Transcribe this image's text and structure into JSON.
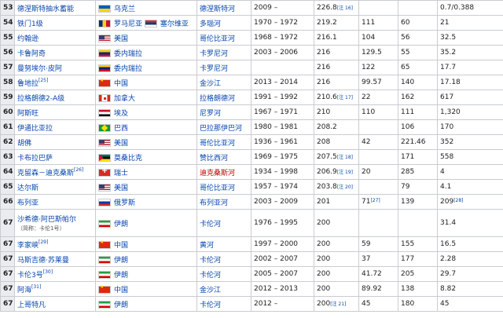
{
  "rows": [
    {
      "rank": "53",
      "name": "德涅斯特抽水蓄能",
      "flags": [
        "ua"
      ],
      "country": "乌克兰",
      "river": "德涅斯特河",
      "years": "2009 –",
      "height": "226.8",
      "height_ref": "[注 16]",
      "c6": "",
      "c7": "",
      "c8": "0.7/0.388"
    },
    {
      "rank": "54",
      "name": "铁门1级",
      "flags": [
        "ro",
        "rs"
      ],
      "country": "罗马尼亚",
      "country2": "塞尔维亚",
      "river": "多瑙河",
      "years": "1970 – 1972",
      "height": "219.2",
      "height_ref": "",
      "c6": "111",
      "c7": "60",
      "c8": "21"
    },
    {
      "rank": "55",
      "name": "约翰逊",
      "flags": [
        "us"
      ],
      "country": "美国",
      "river": "哥伦比亚河",
      "years": "1968 – 1972",
      "height": "216.1",
      "height_ref": "",
      "c6": "104",
      "c7": "56",
      "c8": "32.5"
    },
    {
      "rank": "56",
      "name": "卡鲁阿奇",
      "flags": [
        "ve"
      ],
      "country": "委内瑞拉",
      "river": "卡罗尼河",
      "years": "2003 – 2006",
      "height": "216",
      "height_ref": "",
      "c6": "129.5",
      "c7": "55",
      "c8": "35.2"
    },
    {
      "rank": "57",
      "name": "曼努埃尔·皮阿",
      "flags": [
        "ve"
      ],
      "country": "委内瑞拉",
      "river": "卡罗尼河",
      "years": "",
      "height": "216",
      "height_ref": "",
      "c6": "122",
      "c7": "65",
      "c8": "17.7"
    },
    {
      "rank": "58",
      "name": "鲁地拉",
      "name_ref": "[25]",
      "flags": [
        "cn"
      ],
      "country": "中国",
      "river": "金沙江",
      "years": "2013 – 2014",
      "height": "216",
      "height_ref": "",
      "c6": "99.57",
      "c7": "140",
      "c8": "17.18"
    },
    {
      "rank": "59",
      "name": "拉格朗德2-A级",
      "flags": [
        "ca"
      ],
      "country": "加拿大",
      "river": "拉格朗德河",
      "years": "1991 – 1992",
      "height": "210.6",
      "height_ref": "[注 17]",
      "c6": "22",
      "c7": "162",
      "c8": "617"
    },
    {
      "rank": "60",
      "name": "阿斯旺",
      "flags": [
        "eg"
      ],
      "country": "埃及",
      "river": "尼罗河",
      "years": "1967 – 1971",
      "height": "210",
      "height_ref": "",
      "c6": "110",
      "c7": "111",
      "c8": "1,320"
    },
    {
      "rank": "61",
      "name": "伊通比亚拉",
      "flags": [
        "br"
      ],
      "country": "巴西",
      "river": "巴拉那伊巴河",
      "years": "1980 – 1981",
      "height": "208.2",
      "height_ref": "",
      "c6": "",
      "c7": "106",
      "c8": "170"
    },
    {
      "rank": "62",
      "name": "胡佛",
      "flags": [
        "us"
      ],
      "country": "美国",
      "river": "哥伦比亚河",
      "years": "1936 – 1961",
      "height": "208",
      "height_ref": "",
      "c6": "42",
      "c7": "221.46",
      "c8": "352"
    },
    {
      "rank": "63",
      "name": "卡布拉巴萨",
      "flags": [
        "mz"
      ],
      "country": "莫桑比克",
      "river": "赞比西河",
      "years": "1969 – 1975",
      "height": "207.5",
      "height_ref": "[注 18]",
      "c6": "",
      "c7": "171",
      "c8": "558"
    },
    {
      "rank": "64",
      "name": "克留森－迪克桑斯",
      "name_ref": "[26]",
      "flags": [
        "ch"
      ],
      "country": "瑞士",
      "river": "迪克桑斯河",
      "river_red": true,
      "years": "1934 – 1998",
      "height": "206.9",
      "height_ref": "[注 19]",
      "c6": "20",
      "c7": "285",
      "c8": "4"
    },
    {
      "rank": "65",
      "name": "达尔斯",
      "flags": [
        "us"
      ],
      "country": "美国",
      "river": "哥伦比亚河",
      "years": "1957 – 1974",
      "height": "203.8",
      "height_ref": "[注 20]",
      "c6": "",
      "c7": "79",
      "c8": "4.1"
    },
    {
      "rank": "66",
      "name": "布列亚",
      "flags": [
        "ru"
      ],
      "country": "俄罗斯",
      "river": "布列亚河",
      "years": "2003 – 2009",
      "height": "201",
      "height_ref": "",
      "c6": "71",
      "c6_ref": "[27]",
      "c7": "139",
      "c8": "209",
      "c8_ref": "[28]"
    },
    {
      "rank": "67",
      "name": "沙希德·阿巴斯帕尔",
      "name_sub": "（简称：卡伦1号）",
      "flags": [
        "ir"
      ],
      "country": "伊朗",
      "river": "卡伦河",
      "years": "1976 – 1995",
      "height": "200",
      "height_ref": "",
      "c6": "",
      "c7": "",
      "c8": "31.4",
      "tall": true
    },
    {
      "rank": "67",
      "name": "李家峡",
      "name_ref": "[29]",
      "flags": [
        "cn"
      ],
      "country": "中国",
      "river": "黄河",
      "years": "1997 – 2000",
      "height": "200",
      "height_ref": "",
      "c6": "59",
      "c7": "155",
      "c8": "16.5"
    },
    {
      "rank": "67",
      "name": "马斯吉德·苏莱曼",
      "flags": [
        "ir"
      ],
      "country": "伊朗",
      "river": "卡伦河",
      "years": "2002 – 2007",
      "height": "200",
      "height_ref": "",
      "c6": "37",
      "c7": "177",
      "c8": "2.28"
    },
    {
      "rank": "67",
      "name": "卡伦3号",
      "name_ref": "[30]",
      "flags": [
        "ir"
      ],
      "country": "伊朗",
      "river": "卡伦河",
      "years": "2005 – 2007",
      "height": "200",
      "height_ref": "",
      "c6": "41.72",
      "c7": "205",
      "c8": "29.7"
    },
    {
      "rank": "67",
      "name": "阿海",
      "name_ref": "[31]",
      "flags": [
        "cn"
      ],
      "country": "中国",
      "river": "金沙江",
      "years": "2012 – 2013",
      "height": "200",
      "height_ref": "",
      "c6": "89.92",
      "c7": "138",
      "c8": "8.82"
    },
    {
      "rank": "67",
      "name": "上哥特凡",
      "flags": [
        "ir"
      ],
      "country": "伊朗",
      "river": "卡伦河",
      "years": "2012 –",
      "height": "200",
      "height_ref": "[注 21]",
      "c6": "45",
      "c7": "180",
      "c8": "45"
    }
  ]
}
